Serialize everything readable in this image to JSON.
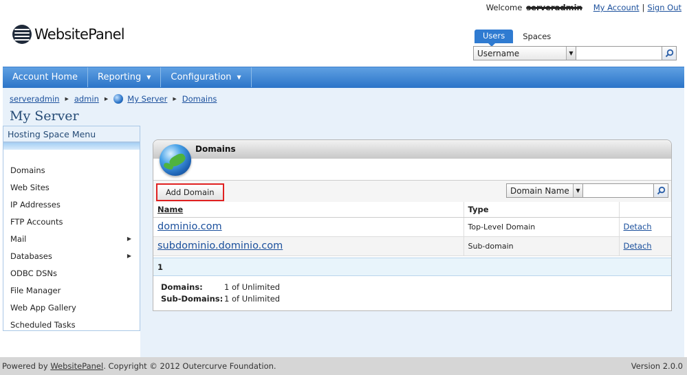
{
  "header": {
    "welcome_label": "Welcome",
    "username": "serveradmin",
    "my_account": "My Account",
    "sign_out": "Sign Out",
    "separator": "|",
    "logo_text": "WebsitePanel"
  },
  "global_search": {
    "tabs": [
      "Users",
      "Spaces"
    ],
    "active_tab": "Users",
    "field_selected": "Username",
    "query": ""
  },
  "nav": {
    "items": [
      {
        "label": "Account Home",
        "has_dropdown": false
      },
      {
        "label": "Reporting",
        "has_dropdown": true
      },
      {
        "label": "Configuration",
        "has_dropdown": true
      }
    ]
  },
  "breadcrumb": {
    "items": [
      "serveradmin",
      "admin",
      "My Server",
      "Domains"
    ]
  },
  "page_title": "My Server",
  "sidebar": {
    "title": "Hosting Space Menu",
    "items": [
      {
        "label": "Domains",
        "submenu": false
      },
      {
        "label": "Web Sites",
        "submenu": false
      },
      {
        "label": "IP Addresses",
        "submenu": false
      },
      {
        "label": "FTP Accounts",
        "submenu": false
      },
      {
        "label": "Mail",
        "submenu": true
      },
      {
        "label": "Databases",
        "submenu": true
      },
      {
        "label": "ODBC DSNs",
        "submenu": false
      },
      {
        "label": "File Manager",
        "submenu": false
      },
      {
        "label": "Web App Gallery",
        "submenu": false
      },
      {
        "label": "Scheduled Tasks",
        "submenu": false
      }
    ]
  },
  "panel": {
    "title": "Domains",
    "add_button": "Add Domain",
    "search_field_selected": "Domain Name",
    "search_query": "",
    "columns": [
      "Name",
      "Type",
      ""
    ],
    "rows": [
      {
        "name": "dominio.com",
        "type": "Top-Level Domain",
        "action": "Detach"
      },
      {
        "name": "subdominio.dominio.com",
        "type": "Sub-domain",
        "action": "Detach"
      }
    ],
    "pager_current": "1",
    "summary": [
      {
        "label": "Domains:",
        "value": "1 of Unlimited"
      },
      {
        "label": "Sub-Domains:",
        "value": "1 of Unlimited"
      }
    ]
  },
  "footer": {
    "powered_prefix": "Powered by",
    "powered_link": "WebsitePanel",
    "copyright": ". Copyright © 2012 Outercurve Foundation.",
    "version": "Version 2.0.0"
  },
  "colors": {
    "nav_blue": "#2b74c8",
    "link_blue": "#1a4f9c",
    "highlight_red": "#e02020",
    "light_blue_bg": "#e8f1fa"
  }
}
